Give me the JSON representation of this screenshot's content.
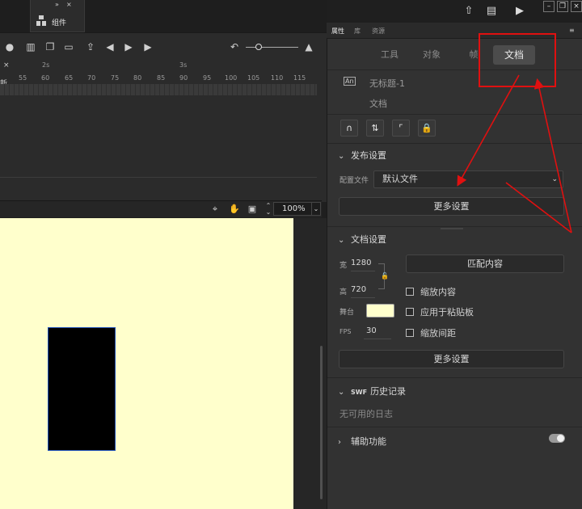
{
  "colors": {
    "stage_bg": "#ffffcc",
    "accent_red": "#e01010",
    "panel_bg": "#323232"
  },
  "components_tab": {
    "label": "组件",
    "collapse": "»",
    "close": "×"
  },
  "timeline": {
    "ruler_seconds": [
      "2s",
      "3s"
    ],
    "ruler_frames": [
      "55",
      "60",
      "65",
      "70",
      "75",
      "80",
      "85",
      "90",
      "95",
      "100",
      "105",
      "110",
      "115"
    ],
    "layer_stub": "新",
    "close_glyph": "×"
  },
  "stage_toolbar": {
    "zoom": "100%"
  },
  "panel": {
    "tabs": [
      "属性",
      "库",
      "资源"
    ],
    "segments": [
      "工具",
      "对象",
      "帧",
      "文档"
    ],
    "active_segment": "文档",
    "doc_name": "无标题-1",
    "doc_type": "文档",
    "publish": {
      "title": "发布设置",
      "profile_label": "配置文件",
      "profile_value": "默认文件",
      "more_settings": "更多设置"
    },
    "doc_settings": {
      "title": "文档设置",
      "width_label": "宽",
      "width_value": "1280",
      "height_label": "高",
      "height_value": "720",
      "match_content": "匹配内容",
      "stage_label": "舞台",
      "fps_label": "FPS",
      "fps_value": "30",
      "scale_content": "缩放内容",
      "apply_pasteboard": "应用于粘贴板",
      "scale_spacing": "缩放间距",
      "more_settings": "更多设置"
    },
    "swf_history": {
      "badge": "SWF",
      "title": "历史记录",
      "empty_text": "无可用的日志"
    },
    "accessibility": {
      "title": "辅助功能"
    }
  }
}
